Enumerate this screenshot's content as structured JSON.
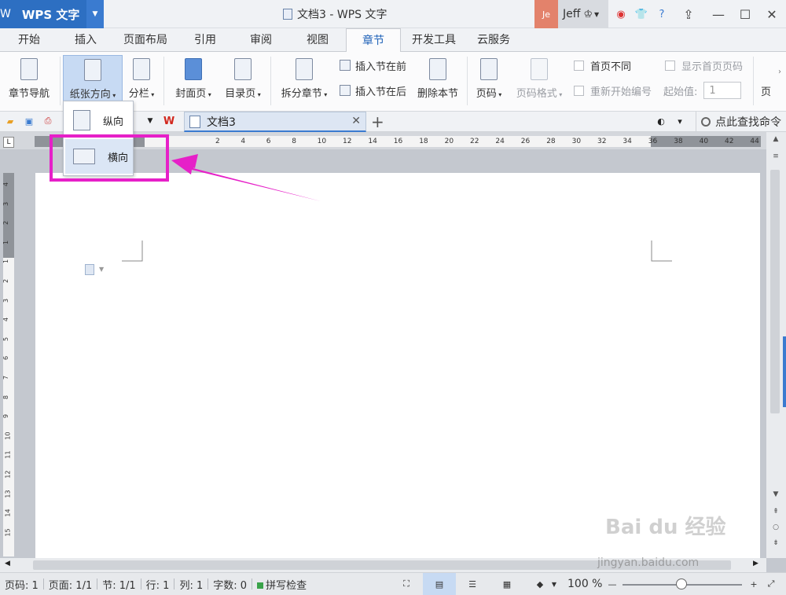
{
  "titlebar": {
    "app_name": "WPS 文字",
    "app_logo": "W",
    "doc_title": "文档3 - WPS 文字",
    "avatar_initials": "Je",
    "user_name": "Jeff"
  },
  "tabs": [
    "开始",
    "插入",
    "页面布局",
    "引用",
    "审阅",
    "视图",
    "章节",
    "开发工具",
    "云服务"
  ],
  "active_tab": "章节",
  "ribbon": {
    "nav": "章节导航",
    "orientation": "纸张方向",
    "columns": "分栏",
    "cover": "封面页",
    "toc": "目录页",
    "split": "拆分章节",
    "insert_before": "插入节在前",
    "insert_after": "插入节在后",
    "delete_section": "删除本节",
    "page_num": "页码",
    "page_num_format": "页码格式",
    "first_diff": "首页不同",
    "restart_numbering": "重新开始编号",
    "show_first_num": "显示首页页码",
    "start_value_label": "起始值:",
    "start_value": "1",
    "header_partial": "页"
  },
  "quickbar": {
    "doc_tab": "文档3",
    "find_command": "点此查找命令"
  },
  "dropdown": {
    "portrait": "纵向",
    "landscape": "横向"
  },
  "ruler_h": [
    "2",
    "4",
    "6",
    "8",
    "10",
    "12",
    "14",
    "16",
    "18",
    "20",
    "22",
    "24",
    "26",
    "28",
    "30",
    "32",
    "34",
    "36",
    "38",
    "40",
    "42",
    "44",
    "46"
  ],
  "ruler_v": [
    "4",
    "3",
    "2",
    "1",
    "1",
    "2",
    "3",
    "4",
    "5",
    "6",
    "7",
    "8",
    "9",
    "10",
    "11",
    "12",
    "13",
    "14",
    "15"
  ],
  "status": {
    "page_code": "页码: 1",
    "page": "页面: 1/1",
    "section": "节: 1/1",
    "row": "行: 1",
    "col": "列: 1",
    "chars": "字数: 0",
    "spell": "拼写检查",
    "zoom": "100 %"
  },
  "watermark": {
    "text": "Bai du 经验",
    "url": "jingyan.baidu.com"
  },
  "colors": {
    "accent": "#2d6fc2",
    "highlight": "#e620c8"
  }
}
